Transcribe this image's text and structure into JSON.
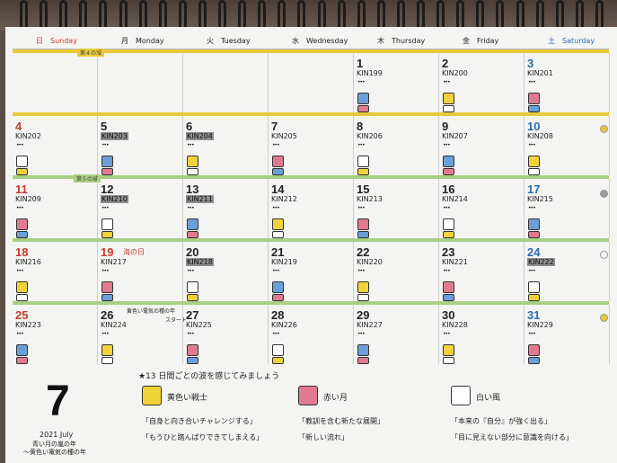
{
  "days": [
    {
      "jp": "日",
      "en": "Sunday",
      "color": "#c83a2c"
    },
    {
      "jp": "月",
      "en": "Monday",
      "color": "#222222"
    },
    {
      "jp": "火",
      "en": "Tuesday",
      "color": "#222222"
    },
    {
      "jp": "水",
      "en": "Wednesday",
      "color": "#222222"
    },
    {
      "jp": "木",
      "en": "Thursday",
      "color": "#222222"
    },
    {
      "jp": "金",
      "en": "Friday",
      "color": "#222222"
    },
    {
      "jp": "土",
      "en": "Saturday",
      "color": "#2d6ab0"
    }
  ],
  "wave_labels": [
    "第４の城",
    "第５の城"
  ],
  "weeks": [
    [
      null,
      null,
      null,
      null,
      {
        "day": "1",
        "kin": "KIN199"
      },
      {
        "day": "2",
        "kin": "KIN200"
      },
      {
        "day": "3",
        "kin": "KIN201"
      }
    ],
    [
      {
        "day": "4",
        "kin": "KIN202"
      },
      {
        "day": "5",
        "kin": "KIN203"
      },
      {
        "day": "6",
        "kin": "KIN204"
      },
      {
        "day": "7",
        "kin": "KIN205"
      },
      {
        "day": "8",
        "kin": "KIN206"
      },
      {
        "day": "9",
        "kin": "KIN207"
      },
      {
        "day": "10",
        "kin": "KIN208"
      }
    ],
    [
      {
        "day": "11",
        "kin": "KIN209"
      },
      {
        "day": "12",
        "kin": "KIN210"
      },
      {
        "day": "13",
        "kin": "KIN211"
      },
      {
        "day": "14",
        "kin": "KIN212"
      },
      {
        "day": "15",
        "kin": "KIN213"
      },
      {
        "day": "16",
        "kin": "KIN214"
      },
      {
        "day": "17",
        "kin": "KIN215"
      }
    ],
    [
      {
        "day": "18",
        "kin": "KIN216"
      },
      {
        "day": "19",
        "kin": "KIN217",
        "holiday": "海の日"
      },
      {
        "day": "20",
        "kin": "KIN218"
      },
      {
        "day": "21",
        "kin": "KIN219"
      },
      {
        "day": "22",
        "kin": "KIN220"
      },
      {
        "day": "23",
        "kin": "KIN221"
      },
      {
        "day": "24",
        "kin": "KIN222"
      }
    ],
    [
      {
        "day": "25",
        "kin": "KIN223"
      },
      {
        "day": "26",
        "kin": "KIN224",
        "note": "黄色い電気の種の年"
      },
      {
        "day": "27",
        "kin": "KIN225",
        "note": "スタート"
      },
      {
        "day": "28",
        "kin": "KIN226"
      },
      {
        "day": "29",
        "kin": "KIN227"
      },
      {
        "day": "30",
        "kin": "KIN228"
      },
      {
        "day": "31",
        "kin": "KIN229"
      }
    ]
  ],
  "footer": {
    "month": "7",
    "year_month": "2021 July",
    "year_name_1": "青い月の嵐の年",
    "year_name_2": "〜黄色い電気の種の年",
    "wave_title": "★13 日間ごとの波を感じてみましょう",
    "legend": [
      {
        "name": "黄色い戦士",
        "quote1": "「自身と向き合いチャレンジする」",
        "quote2": "「もうひと踏んばりできてしまえる」",
        "color": "#f0d23a"
      },
      {
        "name": "赤い月",
        "quote1": "「教訓を含む新たな展開」",
        "quote2": "「新しい流れ」",
        "color": "#e17a90"
      },
      {
        "name": "白い風",
        "quote1": "「本来の『自分』が強く出る」",
        "quote2": "「目に見えない部分に意識を向ける」",
        "color": "#ffffff"
      }
    ]
  }
}
